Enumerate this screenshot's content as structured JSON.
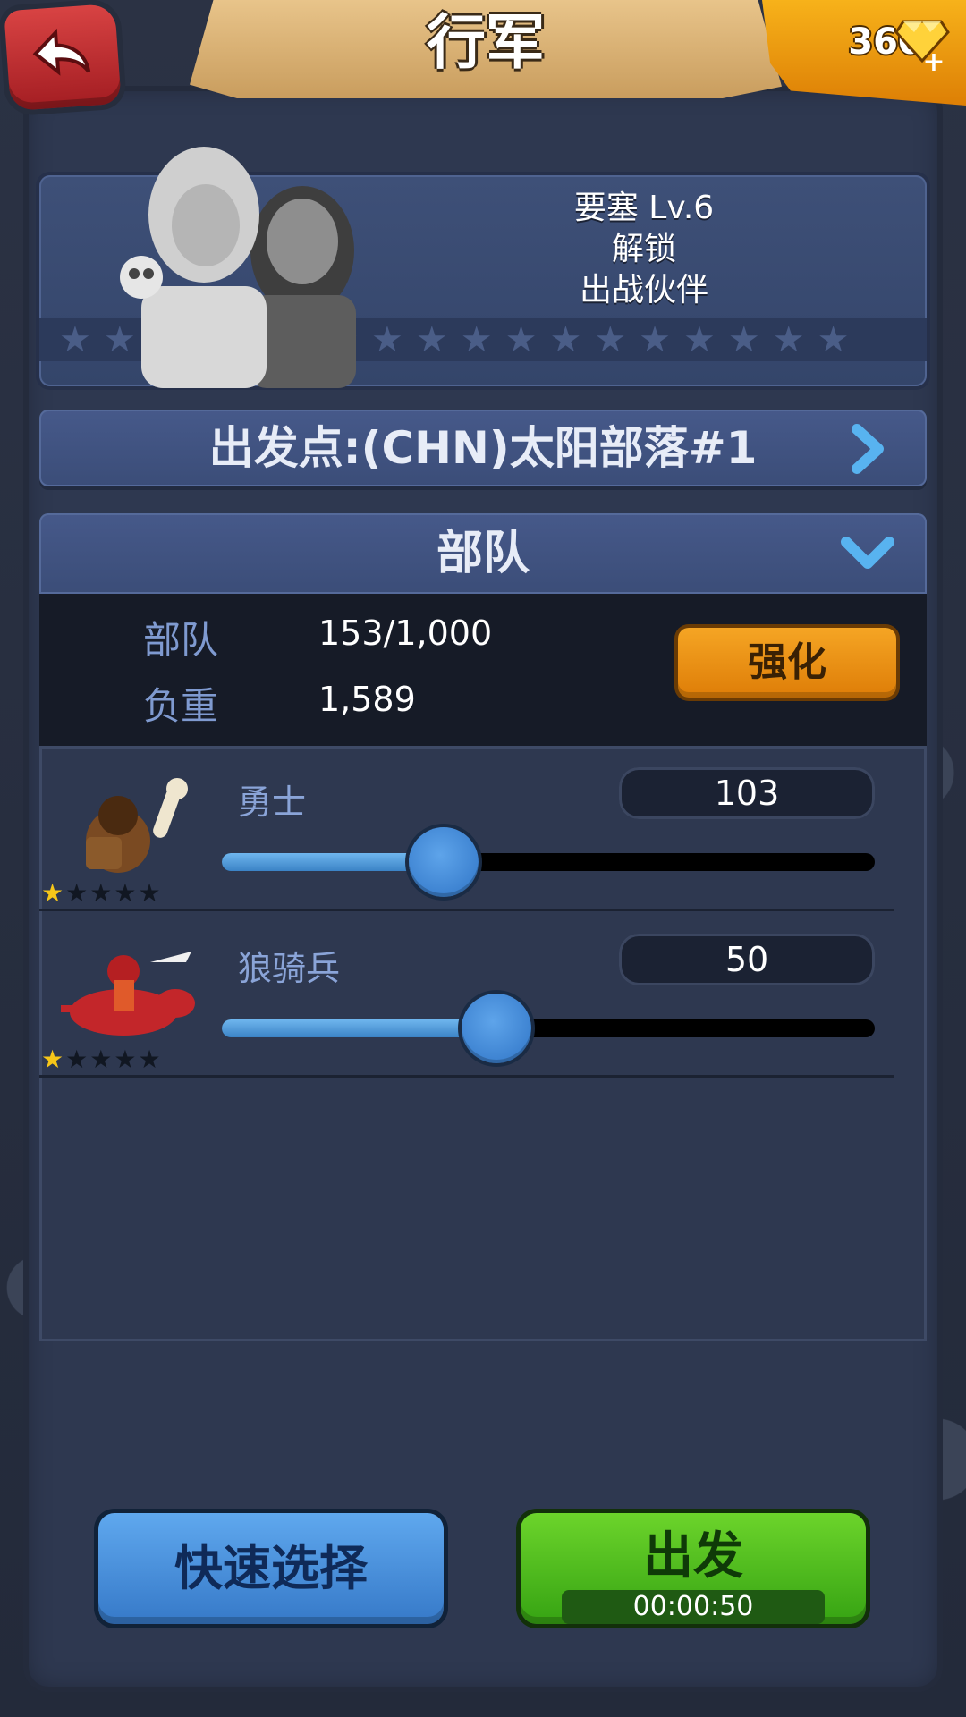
{
  "header": {
    "title": "行军",
    "gems": "360"
  },
  "hero_panel": {
    "line1": "要塞 Lv.6",
    "line2": "解锁",
    "line3": "出战伙伴"
  },
  "origin": {
    "label": "出发点:(CHN)太阳部落#1"
  },
  "troops": {
    "section_title": "部队",
    "stats": {
      "troops_label": "部队",
      "troops_value": "153/1,000",
      "load_label": "负重",
      "load_value": "1,589"
    },
    "boost_label": "强化",
    "units": [
      {
        "name": "勇士",
        "count": "103",
        "slider_fraction": 0.34,
        "stars_filled": 1,
        "stars_total": 5
      },
      {
        "name": "狼骑兵",
        "count": "50",
        "slider_fraction": 0.42,
        "stars_filled": 1,
        "stars_total": 5
      }
    ]
  },
  "footer": {
    "quick_select": "快速选择",
    "depart": "出发",
    "timer": "00:00:50"
  },
  "colors": {
    "accent_orange": "#f5a524",
    "slider_blue": "#3b83c6",
    "go_green": "#36a313",
    "back_red": "#c12b2f"
  },
  "icons": [
    "back-arrow-icon",
    "diamond-gem-icon",
    "plus-icon",
    "chevron-right-icon",
    "chevron-down-icon",
    "star-icon"
  ]
}
